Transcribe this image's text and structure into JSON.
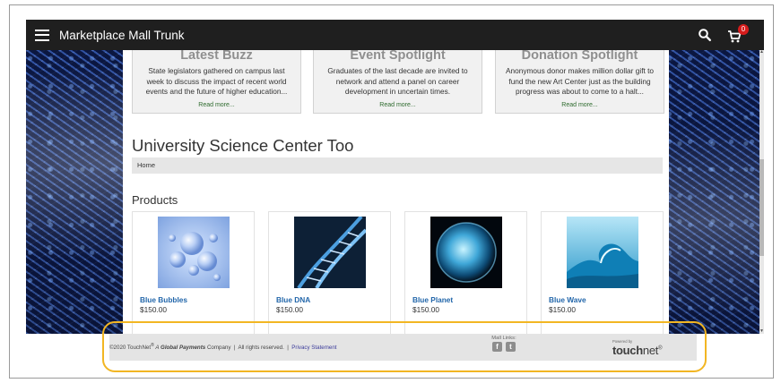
{
  "header": {
    "title": "Marketplace Mall Trunk",
    "cart_count": "0"
  },
  "featured_cards": [
    {
      "title": "Latest Buzz",
      "body": "State legislators gathered on campus last week to discuss the impact of recent world events and the future of higher education...",
      "link": "Read more..."
    },
    {
      "title": "Event Spotlight",
      "body": "Graduates of the last decade are invited to network and attend a panel on career development in uncertain times.",
      "link": "Read more..."
    },
    {
      "title": "Donation Spotlight",
      "body": "Anonymous donor makes million dollar gift to fund the new Art Center just as the building progress was about to come to a halt...",
      "link": "Read more..."
    }
  ],
  "store": {
    "title": "University Science Center Too",
    "breadcrumb": "Home"
  },
  "products_heading": "Products",
  "products": [
    {
      "name": "Blue Bubbles",
      "price": "$150.00",
      "image_icon": "bubbles-image"
    },
    {
      "name": "Blue DNA",
      "price": "$150.00",
      "image_icon": "dna-image"
    },
    {
      "name": "Blue Planet",
      "price": "$150.00",
      "image_icon": "planet-image"
    },
    {
      "name": "Blue Wave",
      "price": "$150.00",
      "image_icon": "wave-image"
    }
  ],
  "footer": {
    "copyright_prefix": "©2020 TouchNet",
    "copyright_reg": "®",
    "copyright_a": " A ",
    "copyright_company": "Global Payments",
    "copyright_suffix": " Company  |  All rights reserved.  |  ",
    "privacy_link": "Privacy Statement",
    "mall_links_label": "Mall Links:",
    "facebook": "f",
    "twitter": "t",
    "powered_by": "Powered by",
    "brand_a": "touch",
    "brand_b": "net",
    "brand_reg": "®"
  },
  "colors": {
    "topbar": "#1f1f1f",
    "accent_link": "#2266aa",
    "highlight": "#f2b623",
    "cart_badge": "#d61c1c"
  }
}
